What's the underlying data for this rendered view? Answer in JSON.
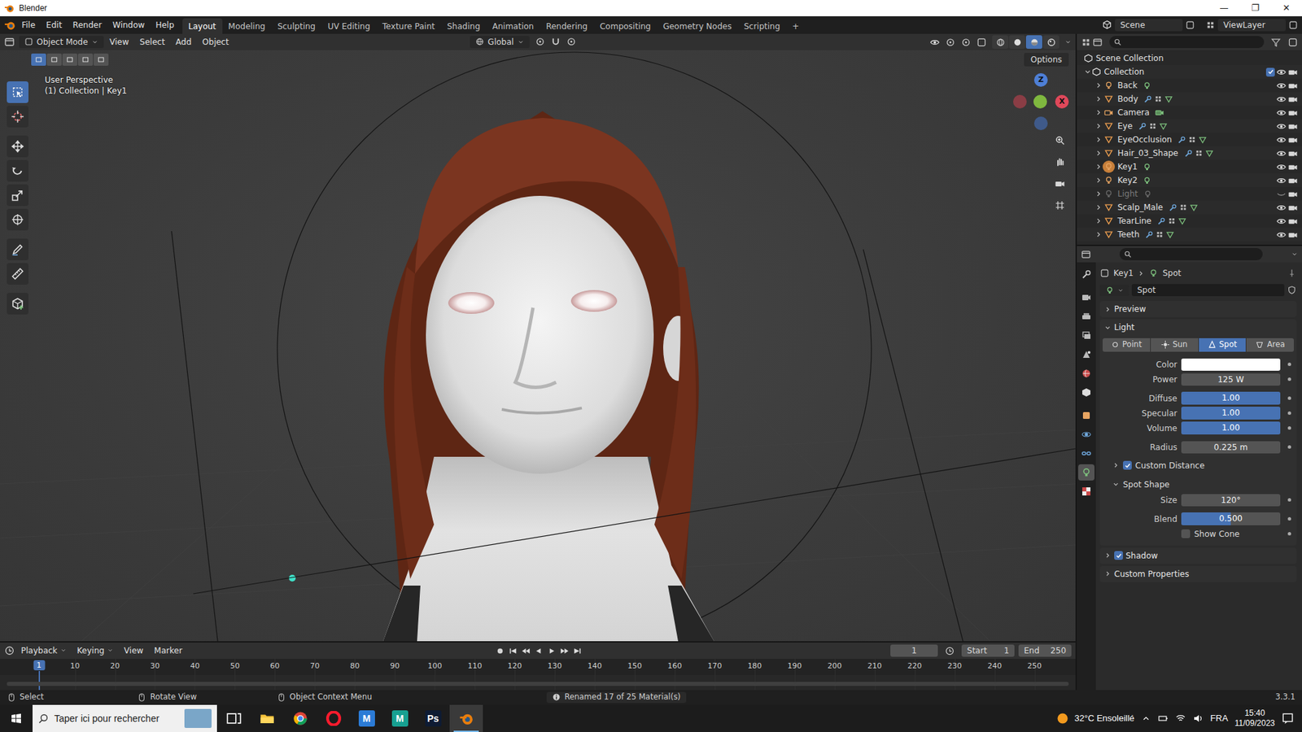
{
  "window": {
    "title": "Blender",
    "controls": [
      "—",
      "❐",
      "✕"
    ]
  },
  "topbar": {
    "menus": [
      "File",
      "Edit",
      "Render",
      "Window",
      "Help"
    ],
    "workspaces": [
      {
        "label": "Layout",
        "selected": true
      },
      {
        "label": "Modeling",
        "selected": false
      },
      {
        "label": "Sculpting",
        "selected": false
      },
      {
        "label": "UV Editing",
        "selected": false
      },
      {
        "label": "Texture Paint",
        "selected": false
      },
      {
        "label": "Shading",
        "selected": false
      },
      {
        "label": "Animation",
        "selected": false
      },
      {
        "label": "Rendering",
        "selected": false
      },
      {
        "label": "Compositing",
        "selected": false
      },
      {
        "label": "Geometry Nodes",
        "selected": false
      },
      {
        "label": "Scripting",
        "selected": false
      }
    ],
    "add_workspace": "+",
    "scene": "Scene",
    "view_layer": "ViewLayer"
  },
  "viewport": {
    "mode": "Object Mode",
    "menus": [
      "View",
      "Select",
      "Add",
      "Object"
    ],
    "orientation": "Global",
    "options": "Options",
    "info": [
      "User Perspective",
      "(1) Collection | Key1"
    ],
    "axes": {
      "z": "Z",
      "x": "X"
    },
    "select_modes": [
      {
        "selected": true
      },
      {
        "selected": false
      },
      {
        "selected": false
      },
      {
        "selected": false
      },
      {
        "selected": false
      }
    ],
    "tools": [
      {
        "kind": "select",
        "selected": true
      },
      {
        "kind": "cursor",
        "selected": false
      },
      {
        "kind": "move",
        "selected": false
      },
      {
        "kind": "rotate",
        "selected": false
      },
      {
        "kind": "scale",
        "selected": false
      },
      {
        "kind": "transform",
        "selected": false
      },
      {
        "kind": "annotate",
        "selected": false
      },
      {
        "kind": "measure",
        "selected": false
      },
      {
        "kind": "add-cube",
        "selected": false
      }
    ],
    "shading": [
      {
        "kind": "wireframe",
        "selected": false
      },
      {
        "kind": "solid",
        "selected": false
      },
      {
        "kind": "material",
        "selected": true
      },
      {
        "kind": "rendered",
        "selected": false
      }
    ]
  },
  "outliner": {
    "root": "Scene Collection",
    "collection": {
      "name": "Collection",
      "checked": true
    },
    "items": [
      {
        "name": "Back",
        "kind": "light",
        "visible": true,
        "active": false
      },
      {
        "name": "Body",
        "kind": "mesh",
        "visible": true,
        "active": false
      },
      {
        "name": "Camera",
        "kind": "camera",
        "visible": true,
        "active": false
      },
      {
        "name": "Eye",
        "kind": "mesh",
        "visible": true,
        "active": false
      },
      {
        "name": "EyeOcclusion",
        "kind": "mesh",
        "visible": true,
        "active": false
      },
      {
        "name": "Hair_03_Shape",
        "kind": "mesh",
        "visible": true,
        "active": false
      },
      {
        "name": "Key1",
        "kind": "light",
        "visible": true,
        "active": true
      },
      {
        "name": "Key2",
        "kind": "light",
        "visible": true,
        "active": false
      },
      {
        "name": "Light",
        "kind": "light",
        "visible": false,
        "active": false
      },
      {
        "name": "Scalp_Male",
        "kind": "mesh",
        "visible": true,
        "active": false
      },
      {
        "name": "TearLine",
        "kind": "mesh",
        "visible": true,
        "active": false
      },
      {
        "name": "Teeth",
        "kind": "mesh",
        "visible": true,
        "active": false
      }
    ]
  },
  "properties": {
    "tabs": [
      {
        "kind": "tool",
        "selected": false
      },
      {
        "kind": "render",
        "selected": false
      },
      {
        "kind": "output",
        "selected": false
      },
      {
        "kind": "view-layer",
        "selected": false
      },
      {
        "kind": "scene",
        "selected": false
      },
      {
        "kind": "world",
        "selected": false
      },
      {
        "kind": "collection",
        "selected": false
      },
      {
        "kind": "object",
        "selected": false
      },
      {
        "kind": "physics",
        "selected": false
      },
      {
        "kind": "constraints",
        "selected": false
      },
      {
        "kind": "data",
        "selected": true
      },
      {
        "kind": "texture",
        "selected": false
      }
    ],
    "breadcrumb": [
      "Key1",
      "Spot"
    ],
    "datablock": "Spot",
    "panels": [
      {
        "label": "Preview",
        "expanded": false
      },
      {
        "label": "Light",
        "expanded": true,
        "types": [
          {
            "label": "Point",
            "selected": false
          },
          {
            "label": "Sun",
            "selected": false
          },
          {
            "label": "Spot",
            "selected": true
          },
          {
            "label": "Area",
            "selected": false
          }
        ],
        "rows": [
          {
            "kind": "color",
            "label": "Color",
            "color": "#ffffff"
          },
          {
            "kind": "number",
            "label": "Power",
            "value": "125 W"
          },
          {
            "kind": "slider",
            "label": "Diffuse",
            "value": "1.00",
            "level": 1
          },
          {
            "kind": "slider",
            "label": "Specular",
            "value": "1.00",
            "level": 1
          },
          {
            "kind": "slider",
            "label": "Volume",
            "value": "1.00",
            "level": 1
          },
          {
            "kind": "number",
            "label": "Radius",
            "value": "0.225 m"
          },
          {
            "kind": "subpanel",
            "label": "Custom Distance",
            "checked": true,
            "expanded": false
          },
          {
            "kind": "subpanel",
            "label": "Spot Shape",
            "expanded": true,
            "rows": [
              {
                "kind": "number",
                "label": "Size",
                "value": "120°"
              },
              {
                "kind": "slider",
                "label": "Blend",
                "value": "0.500",
                "level": 0.5
              },
              {
                "kind": "check",
                "label": "Show Cone",
                "checked": false
              }
            ]
          }
        ]
      },
      {
        "label": "Shadow",
        "expanded": false,
        "checked": true
      },
      {
        "label": "Custom Properties",
        "expanded": false
      }
    ]
  },
  "timeline": {
    "menus": [
      "Playback",
      "Keying",
      "View",
      "Marker"
    ],
    "current": "1",
    "start_label": "Start",
    "start": "1",
    "end_label": "End",
    "end": "250",
    "playhead": "1",
    "ticks": [
      "10",
      "20",
      "30",
      "40",
      "50",
      "60",
      "70",
      "80",
      "90",
      "100",
      "110",
      "120",
      "130",
      "140",
      "150",
      "160",
      "170",
      "180",
      "190",
      "200",
      "210",
      "220",
      "230",
      "240",
      "250"
    ]
  },
  "status_bar": {
    "hints": [
      "Select",
      "Rotate View",
      "Object Context Menu"
    ],
    "message": "Renamed 17 of 25 Material(s)",
    "version": "3.3.1"
  },
  "taskbar": {
    "search": "Taper ici pour rechercher",
    "apps": [
      {
        "kind": "task-view",
        "selected": false
      },
      {
        "kind": "explorer",
        "selected": false
      },
      {
        "kind": "chrome",
        "selected": false
      },
      {
        "kind": "opera",
        "selected": false
      },
      {
        "kind": "letter",
        "label": "M",
        "color": "#2b7bd6",
        "selected": false
      },
      {
        "kind": "letter",
        "label": "M",
        "color": "#17a091",
        "selected": false
      },
      {
        "kind": "letter",
        "label": "Ps",
        "color": "#0e1b33",
        "selected": false
      },
      {
        "kind": "blender",
        "selected": true
      }
    ],
    "weather": "32°C Ensoleillé",
    "language": "FRA",
    "time": "15:40",
    "date": "11/09/2023"
  }
}
